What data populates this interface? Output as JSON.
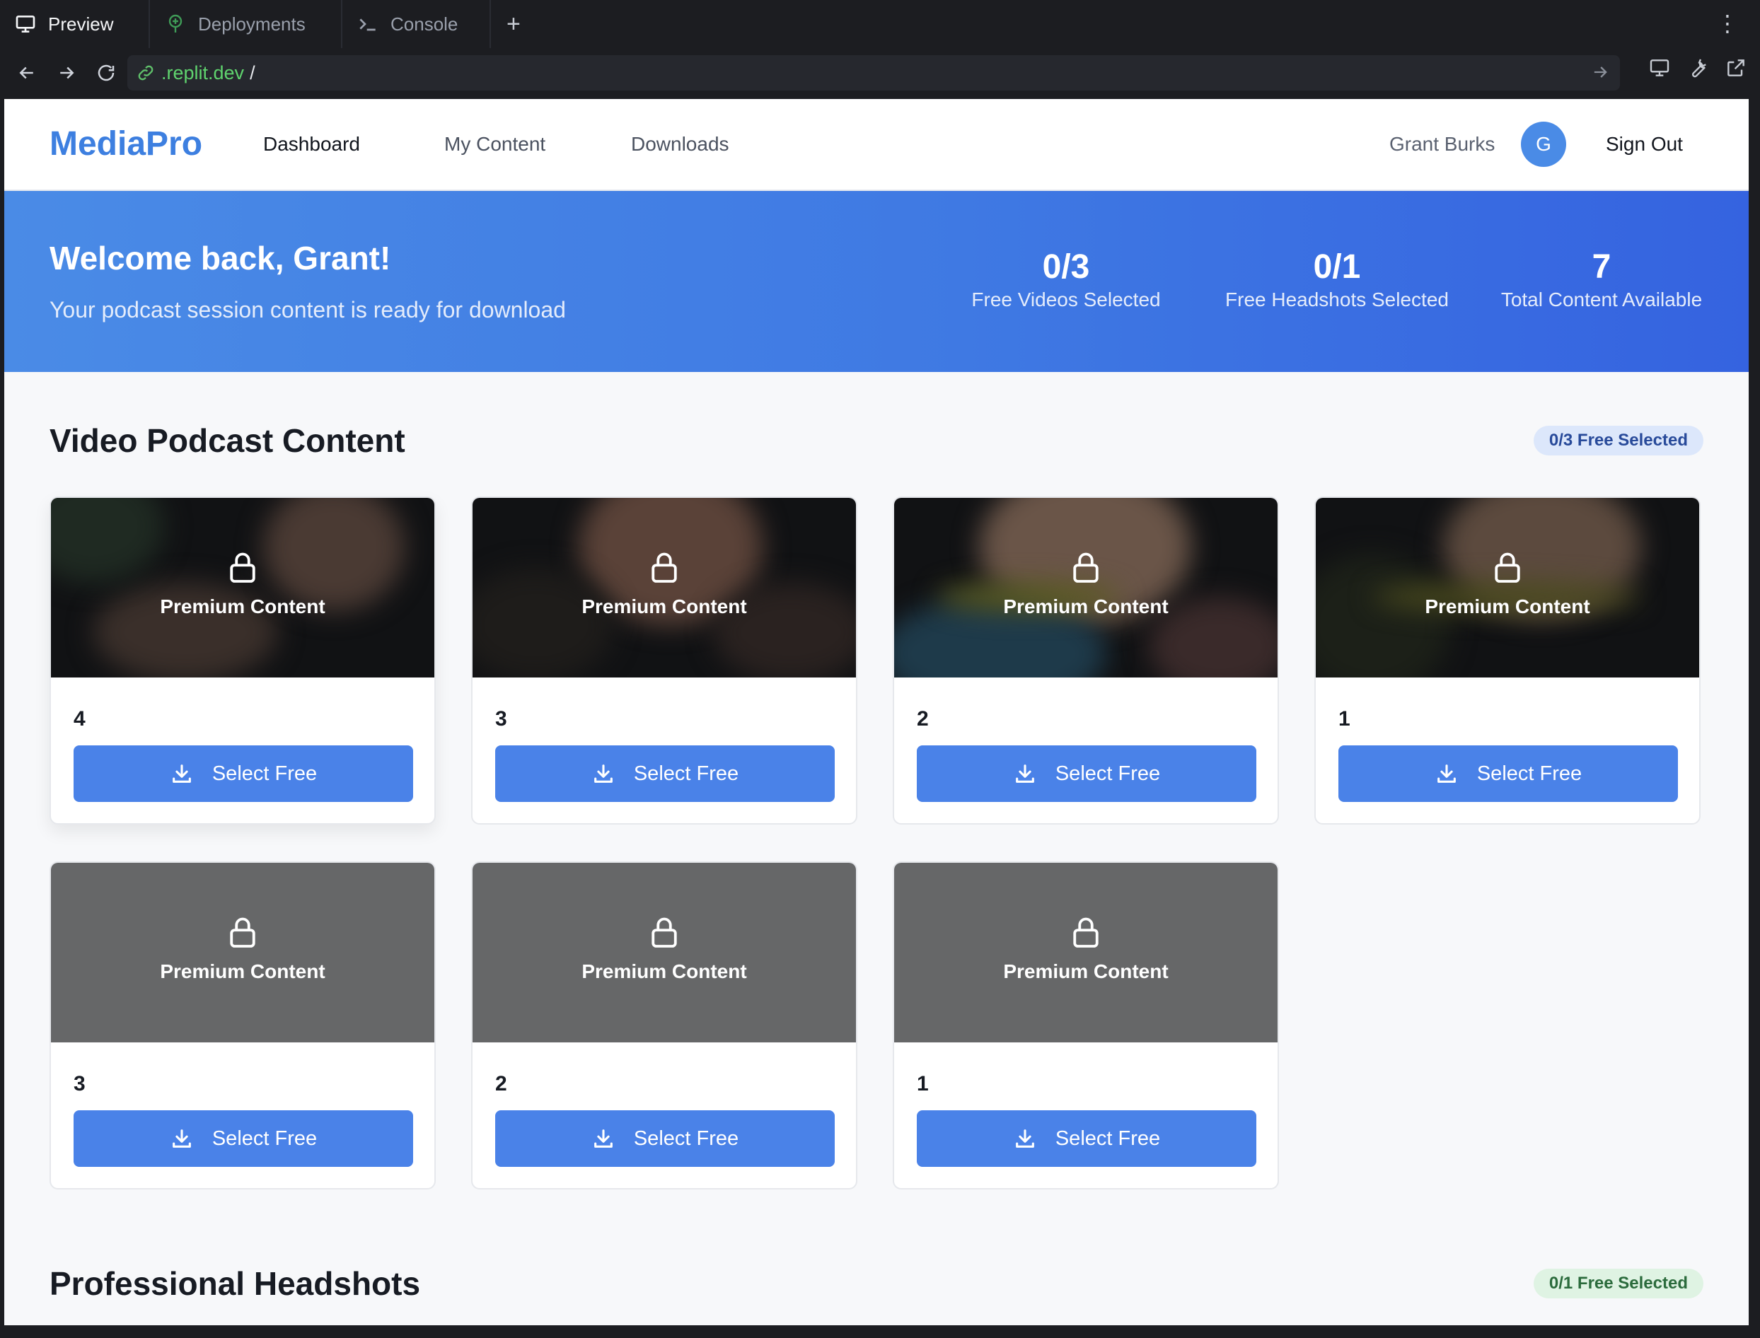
{
  "browser": {
    "tabs": [
      {
        "label": "Preview",
        "icon": "monitor-icon"
      },
      {
        "label": "Deployments",
        "icon": "deploy-icon"
      },
      {
        "label": "Console",
        "icon": "terminal-icon"
      }
    ],
    "new_tab_symbol": "+",
    "more_symbol": "⋮",
    "url_host": ".replit.dev",
    "url_path": "/"
  },
  "app": {
    "logo": "MediaPro",
    "nav": {
      "dashboard": "Dashboard",
      "my_content": "My Content",
      "downloads": "Downloads"
    },
    "user": {
      "name": "Grant Burks",
      "initial": "G"
    },
    "sign_out": "Sign Out",
    "accent_color": "#4a82e8"
  },
  "hero": {
    "title": "Welcome back, Grant!",
    "subtitle": "Your podcast session content is ready for download",
    "stats": [
      {
        "value": "0/3",
        "label": "Free Videos Selected"
      },
      {
        "value": "0/1",
        "label": "Free Headshots Selected"
      },
      {
        "value": "7",
        "label": "Total Content Available"
      }
    ]
  },
  "video_section": {
    "title": "Video Podcast Content",
    "badge": "0/3 Free Selected",
    "cards": [
      {
        "overlay": "Premium Content",
        "number": "4",
        "button": "Select Free",
        "thumb": "dark"
      },
      {
        "overlay": "Premium Content",
        "number": "3",
        "button": "Select Free",
        "thumb": "dark"
      },
      {
        "overlay": "Premium Content",
        "number": "2",
        "button": "Select Free",
        "thumb": "dark"
      },
      {
        "overlay": "Premium Content",
        "number": "1",
        "button": "Select Free",
        "thumb": "dark"
      },
      {
        "overlay": "Premium Content",
        "number": "3",
        "button": "Select Free",
        "thumb": "grey"
      },
      {
        "overlay": "Premium Content",
        "number": "2",
        "button": "Select Free",
        "thumb": "grey"
      },
      {
        "overlay": "Premium Content",
        "number": "1",
        "button": "Select Free",
        "thumb": "grey"
      }
    ]
  },
  "headshot_section": {
    "title": "Professional Headshots",
    "badge": "0/1 Free Selected"
  }
}
